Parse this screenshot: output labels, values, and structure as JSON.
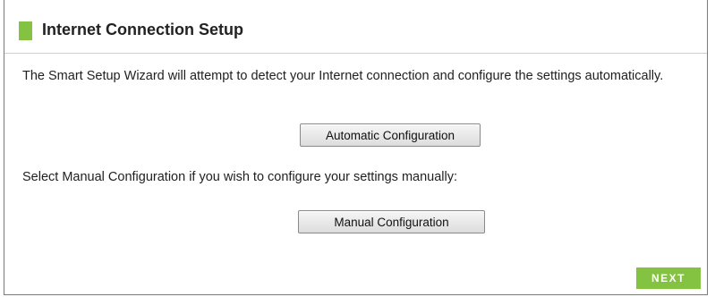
{
  "header": {
    "title": "Internet Connection Setup",
    "marker_color": "#84c341"
  },
  "intro": {
    "text": "The Smart Setup Wizard will attempt to detect your Internet connection and configure the settings automatically."
  },
  "automatic": {
    "button_label": "Automatic Configuration"
  },
  "manual": {
    "text": "Select Manual Configuration if you wish to configure your settings manually:",
    "button_label": "Manual Configuration"
  },
  "footer": {
    "next_label": "NEXT",
    "next_color": "#84c341"
  }
}
